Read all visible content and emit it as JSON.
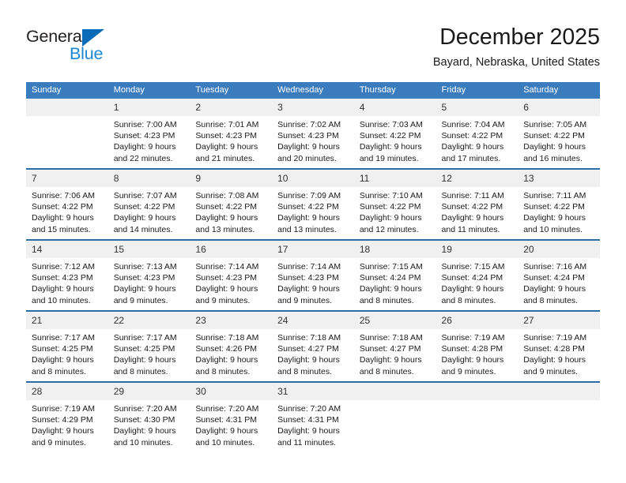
{
  "logo": {
    "word_top": "General",
    "word_bottom": "Blue",
    "triangle_icon": "blue-triangle-icon",
    "brand_blue": "#1b87d4",
    "triangle_color": "#0a6cb8"
  },
  "header": {
    "title": "December 2025",
    "subtitle": "Bayard, Nebraska, United States"
  },
  "theme": {
    "header_blue": "#3b7cbf",
    "row_divider_blue": "#2e6da4",
    "daynum_background": "#f0f0f0"
  },
  "calendar": {
    "weekday_headers": [
      "Sunday",
      "Monday",
      "Tuesday",
      "Wednesday",
      "Thursday",
      "Friday",
      "Saturday"
    ],
    "weeks": [
      [
        {
          "day": "",
          "lines": []
        },
        {
          "day": "1",
          "lines": [
            "Sunrise: 7:00 AM",
            "Sunset: 4:23 PM",
            "Daylight: 9 hours",
            "and 22 minutes."
          ]
        },
        {
          "day": "2",
          "lines": [
            "Sunrise: 7:01 AM",
            "Sunset: 4:23 PM",
            "Daylight: 9 hours",
            "and 21 minutes."
          ]
        },
        {
          "day": "3",
          "lines": [
            "Sunrise: 7:02 AM",
            "Sunset: 4:23 PM",
            "Daylight: 9 hours",
            "and 20 minutes."
          ]
        },
        {
          "day": "4",
          "lines": [
            "Sunrise: 7:03 AM",
            "Sunset: 4:22 PM",
            "Daylight: 9 hours",
            "and 19 minutes."
          ]
        },
        {
          "day": "5",
          "lines": [
            "Sunrise: 7:04 AM",
            "Sunset: 4:22 PM",
            "Daylight: 9 hours",
            "and 17 minutes."
          ]
        },
        {
          "day": "6",
          "lines": [
            "Sunrise: 7:05 AM",
            "Sunset: 4:22 PM",
            "Daylight: 9 hours",
            "and 16 minutes."
          ]
        }
      ],
      [
        {
          "day": "7",
          "lines": [
            "Sunrise: 7:06 AM",
            "Sunset: 4:22 PM",
            "Daylight: 9 hours",
            "and 15 minutes."
          ]
        },
        {
          "day": "8",
          "lines": [
            "Sunrise: 7:07 AM",
            "Sunset: 4:22 PM",
            "Daylight: 9 hours",
            "and 14 minutes."
          ]
        },
        {
          "day": "9",
          "lines": [
            "Sunrise: 7:08 AM",
            "Sunset: 4:22 PM",
            "Daylight: 9 hours",
            "and 13 minutes."
          ]
        },
        {
          "day": "10",
          "lines": [
            "Sunrise: 7:09 AM",
            "Sunset: 4:22 PM",
            "Daylight: 9 hours",
            "and 13 minutes."
          ]
        },
        {
          "day": "11",
          "lines": [
            "Sunrise: 7:10 AM",
            "Sunset: 4:22 PM",
            "Daylight: 9 hours",
            "and 12 minutes."
          ]
        },
        {
          "day": "12",
          "lines": [
            "Sunrise: 7:11 AM",
            "Sunset: 4:22 PM",
            "Daylight: 9 hours",
            "and 11 minutes."
          ]
        },
        {
          "day": "13",
          "lines": [
            "Sunrise: 7:11 AM",
            "Sunset: 4:22 PM",
            "Daylight: 9 hours",
            "and 10 minutes."
          ]
        }
      ],
      [
        {
          "day": "14",
          "lines": [
            "Sunrise: 7:12 AM",
            "Sunset: 4:23 PM",
            "Daylight: 9 hours",
            "and 10 minutes."
          ]
        },
        {
          "day": "15",
          "lines": [
            "Sunrise: 7:13 AM",
            "Sunset: 4:23 PM",
            "Daylight: 9 hours",
            "and 9 minutes."
          ]
        },
        {
          "day": "16",
          "lines": [
            "Sunrise: 7:14 AM",
            "Sunset: 4:23 PM",
            "Daylight: 9 hours",
            "and 9 minutes."
          ]
        },
        {
          "day": "17",
          "lines": [
            "Sunrise: 7:14 AM",
            "Sunset: 4:23 PM",
            "Daylight: 9 hours",
            "and 9 minutes."
          ]
        },
        {
          "day": "18",
          "lines": [
            "Sunrise: 7:15 AM",
            "Sunset: 4:24 PM",
            "Daylight: 9 hours",
            "and 8 minutes."
          ]
        },
        {
          "day": "19",
          "lines": [
            "Sunrise: 7:15 AM",
            "Sunset: 4:24 PM",
            "Daylight: 9 hours",
            "and 8 minutes."
          ]
        },
        {
          "day": "20",
          "lines": [
            "Sunrise: 7:16 AM",
            "Sunset: 4:24 PM",
            "Daylight: 9 hours",
            "and 8 minutes."
          ]
        }
      ],
      [
        {
          "day": "21",
          "lines": [
            "Sunrise: 7:17 AM",
            "Sunset: 4:25 PM",
            "Daylight: 9 hours",
            "and 8 minutes."
          ]
        },
        {
          "day": "22",
          "lines": [
            "Sunrise: 7:17 AM",
            "Sunset: 4:25 PM",
            "Daylight: 9 hours",
            "and 8 minutes."
          ]
        },
        {
          "day": "23",
          "lines": [
            "Sunrise: 7:18 AM",
            "Sunset: 4:26 PM",
            "Daylight: 9 hours",
            "and 8 minutes."
          ]
        },
        {
          "day": "24",
          "lines": [
            "Sunrise: 7:18 AM",
            "Sunset: 4:27 PM",
            "Daylight: 9 hours",
            "and 8 minutes."
          ]
        },
        {
          "day": "25",
          "lines": [
            "Sunrise: 7:18 AM",
            "Sunset: 4:27 PM",
            "Daylight: 9 hours",
            "and 8 minutes."
          ]
        },
        {
          "day": "26",
          "lines": [
            "Sunrise: 7:19 AM",
            "Sunset: 4:28 PM",
            "Daylight: 9 hours",
            "and 9 minutes."
          ]
        },
        {
          "day": "27",
          "lines": [
            "Sunrise: 7:19 AM",
            "Sunset: 4:28 PM",
            "Daylight: 9 hours",
            "and 9 minutes."
          ]
        }
      ],
      [
        {
          "day": "28",
          "lines": [
            "Sunrise: 7:19 AM",
            "Sunset: 4:29 PM",
            "Daylight: 9 hours",
            "and 9 minutes."
          ]
        },
        {
          "day": "29",
          "lines": [
            "Sunrise: 7:20 AM",
            "Sunset: 4:30 PM",
            "Daylight: 9 hours",
            "and 10 minutes."
          ]
        },
        {
          "day": "30",
          "lines": [
            "Sunrise: 7:20 AM",
            "Sunset: 4:31 PM",
            "Daylight: 9 hours",
            "and 10 minutes."
          ]
        },
        {
          "day": "31",
          "lines": [
            "Sunrise: 7:20 AM",
            "Sunset: 4:31 PM",
            "Daylight: 9 hours",
            "and 11 minutes."
          ]
        },
        {
          "day": "",
          "lines": []
        },
        {
          "day": "",
          "lines": []
        },
        {
          "day": "",
          "lines": []
        }
      ]
    ]
  }
}
